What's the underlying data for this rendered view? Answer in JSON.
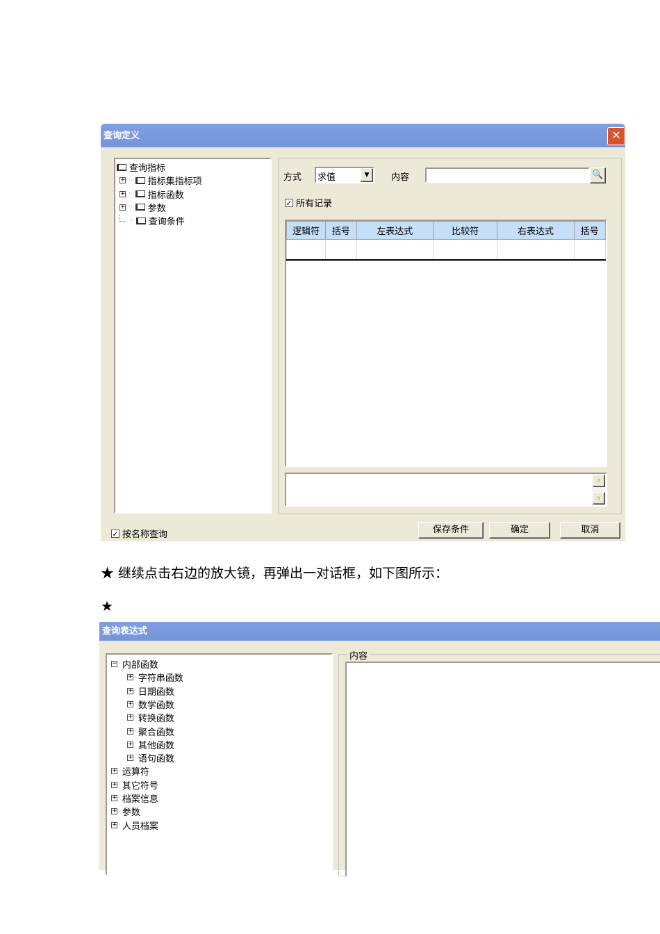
{
  "dialog1": {
    "title": "查询定义",
    "tree": [
      {
        "label": "查询指标",
        "expander": ""
      },
      {
        "label": "指标集指标项",
        "expander": "+"
      },
      {
        "label": "指标函数",
        "expander": "+"
      },
      {
        "label": "参数",
        "expander": "+"
      },
      {
        "label": "查询条件",
        "expander": ""
      }
    ],
    "mode_label": "方式",
    "mode_value": "求值",
    "content_label": "内容",
    "content_value": "",
    "all_records_label": "所有记录",
    "all_records_checked": true,
    "columns": [
      "逻辑符",
      "括号",
      "左表达式",
      "比较符",
      "右表达式",
      "括号"
    ],
    "by_name_label": "按名称查询",
    "by_name_checked": true,
    "buttons": {
      "save": "保存条件",
      "ok": "确定",
      "cancel": "取消"
    }
  },
  "paragraph": "★ 继续点击右边的放大镜，再弹出一对话框，如下图所示：",
  "star": "★",
  "dialog2": {
    "title": "查询表达式",
    "content_label": "内容",
    "tree": [
      {
        "label": "内部函数",
        "expander": "-",
        "level": 0
      },
      {
        "label": "字符串函数",
        "expander": "+",
        "level": 1
      },
      {
        "label": "日期函数",
        "expander": "+",
        "level": 1
      },
      {
        "label": "数学函数",
        "expander": "+",
        "level": 1
      },
      {
        "label": "转换函数",
        "expander": "+",
        "level": 1
      },
      {
        "label": "聚合函数",
        "expander": "+",
        "level": 1
      },
      {
        "label": "其他函数",
        "expander": "+",
        "level": 1
      },
      {
        "label": "语句函数",
        "expander": "+",
        "level": 1
      },
      {
        "label": "运算符",
        "expander": "+",
        "level": 0
      },
      {
        "label": "其它符号",
        "expander": "+",
        "level": 0
      },
      {
        "label": "档案信息",
        "expander": "+",
        "level": 0
      },
      {
        "label": "参数",
        "expander": "+",
        "level": 0
      },
      {
        "label": "人员档案",
        "expander": "+",
        "level": 0
      }
    ]
  }
}
